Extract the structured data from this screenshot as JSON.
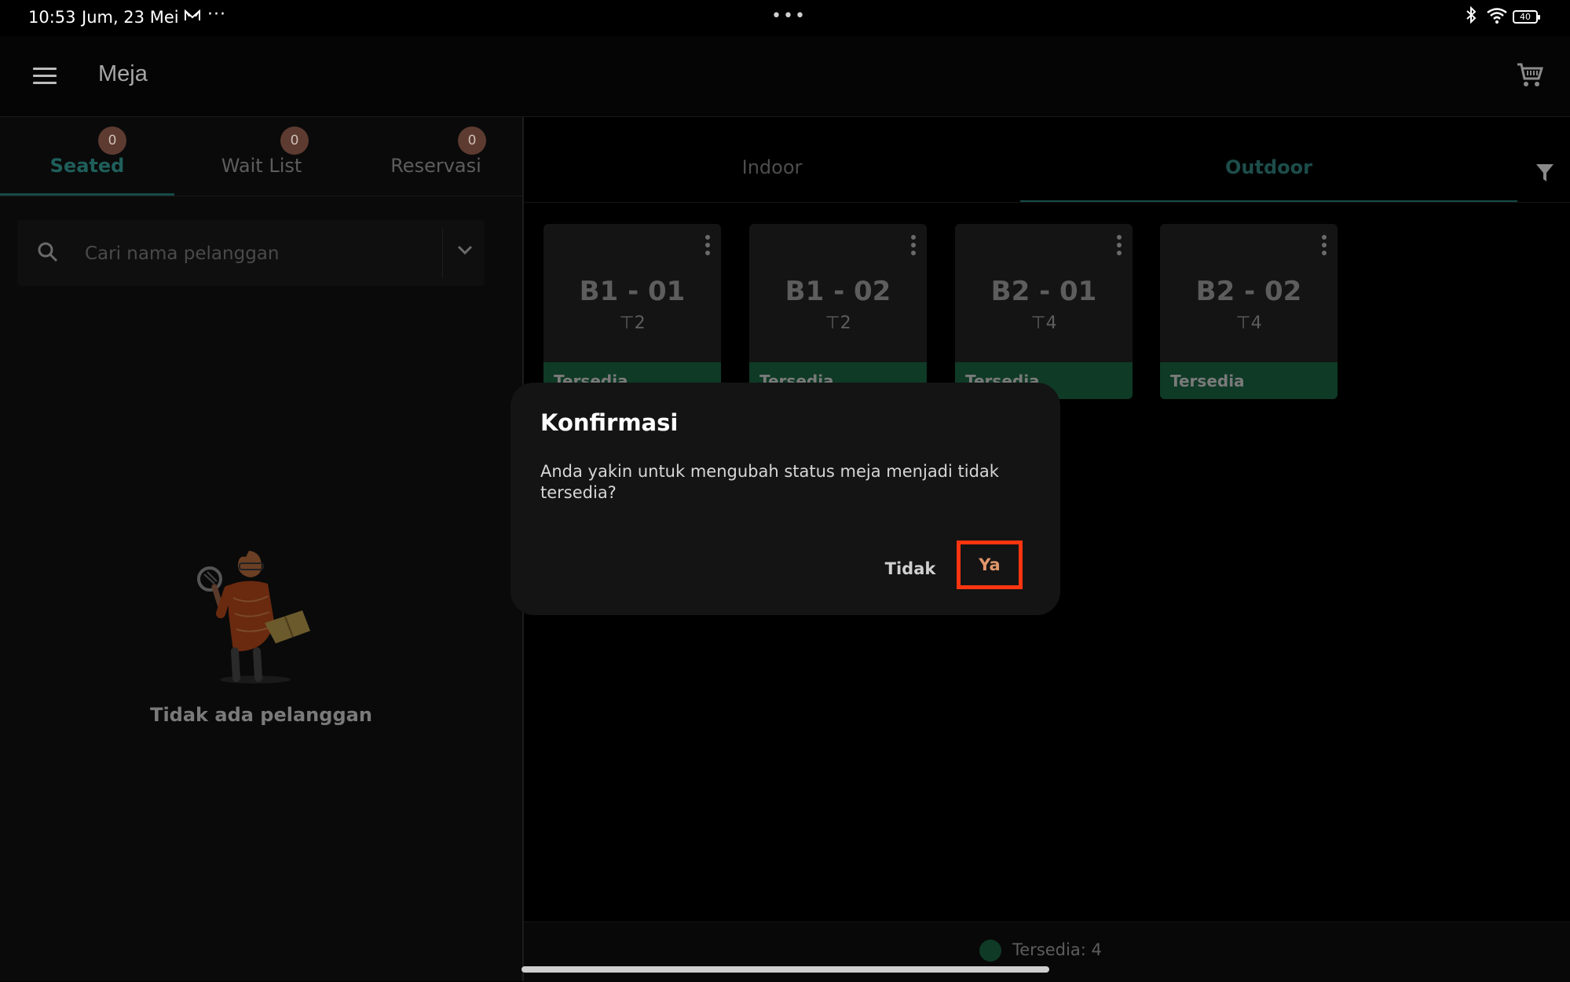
{
  "status_bar": {
    "time": "10:53",
    "date": "Jum, 23 Mei",
    "more": "···",
    "center_dots": "•••",
    "battery": "40"
  },
  "app_bar": {
    "title": "Meja"
  },
  "left_panel": {
    "tabs": [
      {
        "label": "Seated",
        "badge": "0",
        "active": true
      },
      {
        "label": "Wait List",
        "badge": "0",
        "active": false
      },
      {
        "label": "Reservasi",
        "badge": "0",
        "active": false
      }
    ],
    "search": {
      "placeholder": "Cari nama pelanggan",
      "value": ""
    },
    "empty_state_text": "Tidak ada pelanggan"
  },
  "right_panel": {
    "tabs": [
      {
        "label": "Indoor",
        "active": false
      },
      {
        "label": "Outdoor",
        "active": true
      }
    ],
    "tables": [
      {
        "name": "B1 - 01",
        "seats": "2",
        "status": "Tersedia"
      },
      {
        "name": "B1 - 02",
        "seats": "2",
        "status": "Tersedia"
      },
      {
        "name": "B2 - 01",
        "seats": "4",
        "status": "Tersedia"
      },
      {
        "name": "B2 - 02",
        "seats": "4",
        "status": "Tersedia"
      }
    ],
    "legend": {
      "label": "Tersedia: 4",
      "color": "#0f3a26"
    }
  },
  "dialog": {
    "title": "Konfirmasi",
    "message": "Anda yakin untuk mengubah status meja menjadi tidak tersedia?",
    "cancel_label": "Tidak",
    "confirm_label": "Ya",
    "highlight_color": "#ff3510"
  },
  "icons": [
    "menu-icon",
    "cart-icon",
    "search-icon",
    "chevron-down-icon",
    "filter-icon",
    "kebab-menu-icon",
    "table-seat-icon",
    "bluetooth-icon",
    "wifi-icon",
    "battery-icon",
    "mail-icon"
  ]
}
